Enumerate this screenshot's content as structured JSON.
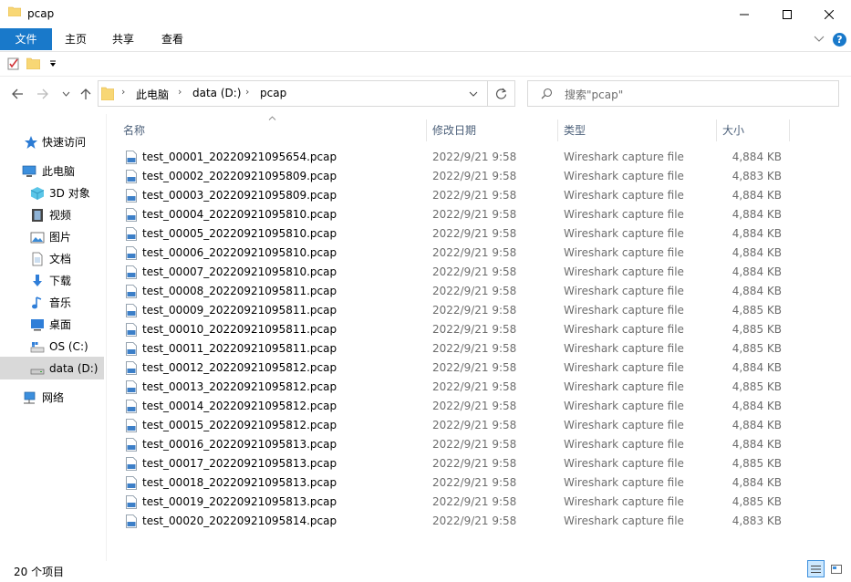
{
  "window": {
    "title": "pcap"
  },
  "ribbon": {
    "tabs": [
      "文件",
      "主页",
      "共享",
      "查看"
    ]
  },
  "address": {
    "crumbs": [
      "此电脑",
      "data (D:)",
      "pcap"
    ]
  },
  "search": {
    "placeholder": "搜索\"pcap\""
  },
  "sidebar": {
    "items": [
      {
        "label": "快速访问",
        "icon": "star-icon"
      },
      {
        "label": "此电脑",
        "icon": "computer-icon"
      },
      {
        "label": "3D 对象",
        "icon": "cube-icon"
      },
      {
        "label": "视频",
        "icon": "film-icon"
      },
      {
        "label": "图片",
        "icon": "picture-icon"
      },
      {
        "label": "文档",
        "icon": "document-icon"
      },
      {
        "label": "下载",
        "icon": "download-icon"
      },
      {
        "label": "音乐",
        "icon": "music-icon"
      },
      {
        "label": "桌面",
        "icon": "desktop-icon"
      },
      {
        "label": "OS (C:)",
        "icon": "drive-icon"
      },
      {
        "label": "data (D:)",
        "icon": "drive-icon"
      },
      {
        "label": "网络",
        "icon": "network-icon"
      }
    ]
  },
  "columns": {
    "name": "名称",
    "date": "修改日期",
    "type": "类型",
    "size": "大小"
  },
  "files": [
    {
      "name": "test_00001_20220921095654.pcap",
      "date": "2022/9/21 9:58",
      "type": "Wireshark capture file",
      "size": "4,884 KB"
    },
    {
      "name": "test_00002_20220921095809.pcap",
      "date": "2022/9/21 9:58",
      "type": "Wireshark capture file",
      "size": "4,883 KB"
    },
    {
      "name": "test_00003_20220921095809.pcap",
      "date": "2022/9/21 9:58",
      "type": "Wireshark capture file",
      "size": "4,884 KB"
    },
    {
      "name": "test_00004_20220921095810.pcap",
      "date": "2022/9/21 9:58",
      "type": "Wireshark capture file",
      "size": "4,884 KB"
    },
    {
      "name": "test_00005_20220921095810.pcap",
      "date": "2022/9/21 9:58",
      "type": "Wireshark capture file",
      "size": "4,884 KB"
    },
    {
      "name": "test_00006_20220921095810.pcap",
      "date": "2022/9/21 9:58",
      "type": "Wireshark capture file",
      "size": "4,884 KB"
    },
    {
      "name": "test_00007_20220921095810.pcap",
      "date": "2022/9/21 9:58",
      "type": "Wireshark capture file",
      "size": "4,884 KB"
    },
    {
      "name": "test_00008_20220921095811.pcap",
      "date": "2022/9/21 9:58",
      "type": "Wireshark capture file",
      "size": "4,884 KB"
    },
    {
      "name": "test_00009_20220921095811.pcap",
      "date": "2022/9/21 9:58",
      "type": "Wireshark capture file",
      "size": "4,885 KB"
    },
    {
      "name": "test_00010_20220921095811.pcap",
      "date": "2022/9/21 9:58",
      "type": "Wireshark capture file",
      "size": "4,885 KB"
    },
    {
      "name": "test_00011_20220921095811.pcap",
      "date": "2022/9/21 9:58",
      "type": "Wireshark capture file",
      "size": "4,885 KB"
    },
    {
      "name": "test_00012_20220921095812.pcap",
      "date": "2022/9/21 9:58",
      "type": "Wireshark capture file",
      "size": "4,884 KB"
    },
    {
      "name": "test_00013_20220921095812.pcap",
      "date": "2022/9/21 9:58",
      "type": "Wireshark capture file",
      "size": "4,885 KB"
    },
    {
      "name": "test_00014_20220921095812.pcap",
      "date": "2022/9/21 9:58",
      "type": "Wireshark capture file",
      "size": "4,884 KB"
    },
    {
      "name": "test_00015_20220921095812.pcap",
      "date": "2022/9/21 9:58",
      "type": "Wireshark capture file",
      "size": "4,884 KB"
    },
    {
      "name": "test_00016_20220921095813.pcap",
      "date": "2022/9/21 9:58",
      "type": "Wireshark capture file",
      "size": "4,884 KB"
    },
    {
      "name": "test_00017_20220921095813.pcap",
      "date": "2022/9/21 9:58",
      "type": "Wireshark capture file",
      "size": "4,885 KB"
    },
    {
      "name": "test_00018_20220921095813.pcap",
      "date": "2022/9/21 9:58",
      "type": "Wireshark capture file",
      "size": "4,884 KB"
    },
    {
      "name": "test_00019_20220921095813.pcap",
      "date": "2022/9/21 9:58",
      "type": "Wireshark capture file",
      "size": "4,885 KB"
    },
    {
      "name": "test_00020_20220921095814.pcap",
      "date": "2022/9/21 9:58",
      "type": "Wireshark capture file",
      "size": "4,883 KB"
    }
  ],
  "status": {
    "count": "20 个项目"
  },
  "colors": {
    "accent": "#1979ca",
    "selected": "#cce8ff",
    "sidebar_selected": "#d9d9d9",
    "header_text": "#4c607a",
    "secondary_text": "#6d6d6d"
  }
}
